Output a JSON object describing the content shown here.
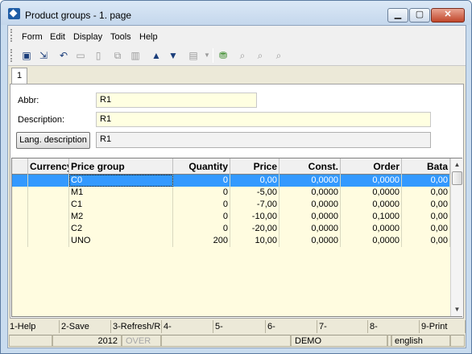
{
  "window": {
    "title": "Product groups - 1. page"
  },
  "menu": [
    "Form",
    "Edit",
    "Display",
    "Tools",
    "Help"
  ],
  "tabs": [
    "1"
  ],
  "form": {
    "abbr_label": "Abbr:",
    "abbr_value": "R1",
    "description_label": "Description:",
    "description_value": "R1",
    "lang_button": "Lang. description",
    "lang_value": "R1"
  },
  "grid": {
    "columns": [
      "Currency",
      "Price group",
      "Quantity",
      "Price",
      "Const.",
      "Order",
      "Bata"
    ],
    "rows": [
      {
        "currency": "",
        "group": "C0",
        "quantity": "0",
        "price": "0,00",
        "const": "0,0000",
        "order": "0,0000",
        "bata": "0,00"
      },
      {
        "currency": "",
        "group": "M1",
        "quantity": "0",
        "price": "-5,00",
        "const": "0,0000",
        "order": "0,0000",
        "bata": "0,00"
      },
      {
        "currency": "",
        "group": "C1",
        "quantity": "0",
        "price": "-7,00",
        "const": "0,0000",
        "order": "0,0000",
        "bata": "0,00"
      },
      {
        "currency": "",
        "group": "M2",
        "quantity": "0",
        "price": "-10,00",
        "const": "0,0000",
        "order": "0,1000",
        "bata": "0,00"
      },
      {
        "currency": "",
        "group": "C2",
        "quantity": "0",
        "price": "-20,00",
        "const": "0,0000",
        "order": "0,0000",
        "bata": "0,00"
      },
      {
        "currency": "",
        "group": "UNO",
        "quantity": "200",
        "price": "10,00",
        "const": "0,0000",
        "order": "0,0000",
        "bata": "0,00"
      }
    ]
  },
  "fkeys": [
    "1-Help",
    "2-Save",
    "3-Refresh/R",
    "4-",
    "5-",
    "6-",
    "7-",
    "8-",
    "9-Print"
  ],
  "status": [
    "",
    "2012",
    "OVER",
    "",
    "DEMO",
    "",
    "english",
    ""
  ],
  "colors": {
    "selection": "#3399ff",
    "field_bg": "#ffffe1",
    "grid_bg": "#fffce0",
    "window_frame": "#c9dcef"
  }
}
